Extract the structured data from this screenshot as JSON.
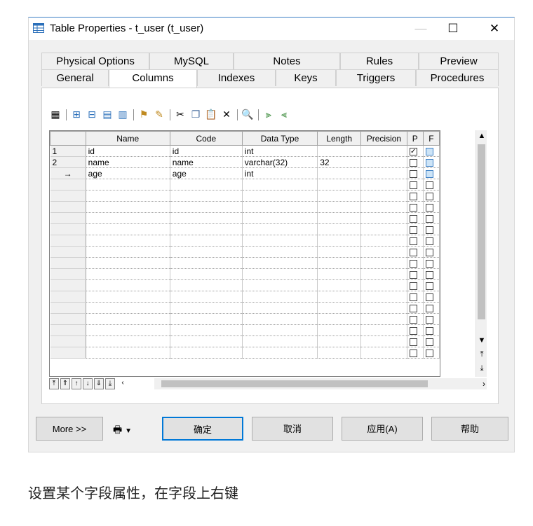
{
  "window": {
    "title": "Table Properties - t_user (t_user)",
    "controls": {
      "minimize": "—",
      "maximize": "☐",
      "close": "✕"
    }
  },
  "tabs_row1": [
    "Physical Options",
    "MySQL",
    "Notes",
    "Rules",
    "Preview"
  ],
  "tabs_row2": [
    "General",
    "Columns",
    "Indexes",
    "Keys",
    "Triggers",
    "Procedures"
  ],
  "active_tab": "Columns",
  "grid": {
    "headers": [
      "",
      "Name",
      "Code",
      "Data Type",
      "Length",
      "Precision",
      "P",
      "F"
    ],
    "rows": [
      {
        "num": "1",
        "name": "id",
        "code": "id",
        "type": "int",
        "length": "",
        "precision": "",
        "p": true,
        "f": false
      },
      {
        "num": "2",
        "name": "name",
        "code": "name",
        "type": "varchar(32)",
        "length": "32",
        "precision": "",
        "p": false,
        "f": false
      },
      {
        "num": "→",
        "name": "age",
        "code": "age",
        "type": "int",
        "length": "",
        "precision": "",
        "p": false,
        "f": false
      }
    ],
    "empty_rows": 16
  },
  "buttons": {
    "more": "More >>",
    "ok": "确定",
    "cancel": "取消",
    "apply": "应用(A)",
    "help": "帮助"
  },
  "caption": "设置某个字段属性，在字段上右键"
}
